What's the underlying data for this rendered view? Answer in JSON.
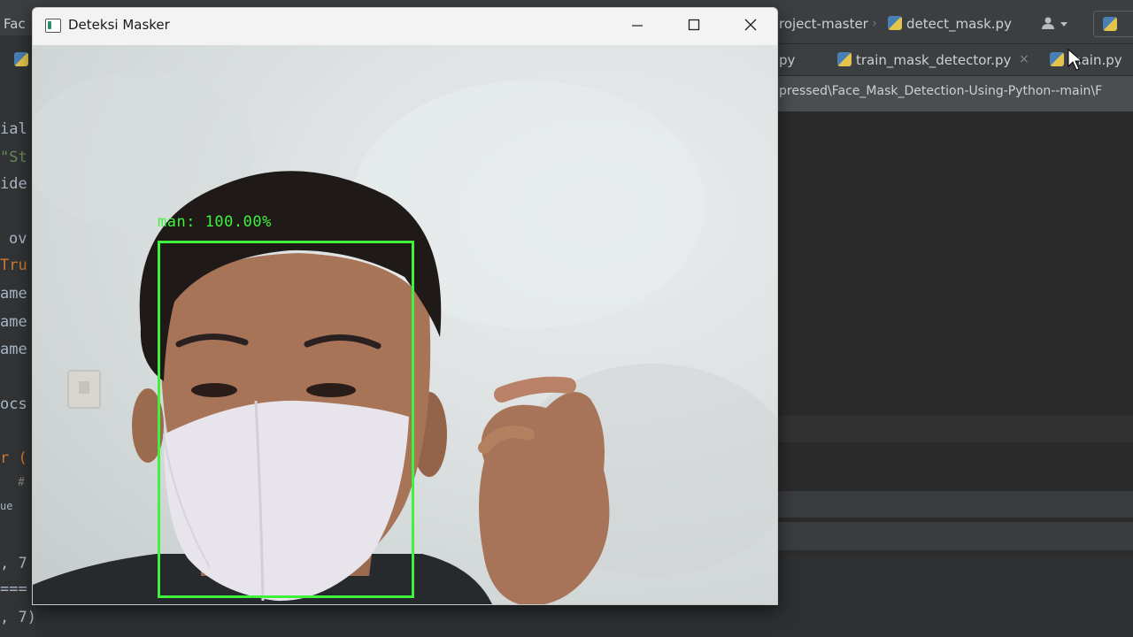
{
  "ide": {
    "project_label_fragment": "Fac",
    "breadcrumb_project": "roject-master",
    "breadcrumb_file": "detect_mask.py",
    "tabs": [
      {
        "label": "py"
      },
      {
        "label": "train_mask_detector.py",
        "close": "×"
      },
      {
        "label": "main.py"
      }
    ],
    "path_text": "pressed\\Face_Mask_Detection-Using-Python--main\\F",
    "code_fragments": [
      "ial",
      "\"St",
      "ide",
      "ov",
      "Tru",
      "ame",
      "ame",
      "ame",
      "ocs",
      "r (",
      "#",
      "ue",
      ", 7",
      "===",
      ", 7)"
    ]
  },
  "window": {
    "title": "Deteksi Masker",
    "minimize_icon": "minimize-icon",
    "maximize_icon": "maximize-icon",
    "close_icon": "close-icon"
  },
  "detection": {
    "label": "man: 100.00%",
    "confidence_percent": 100.0,
    "box_color": "#3ef23e"
  },
  "colors": {
    "ide_bg": "#2b2b2b",
    "ide_toolbar": "#3c3f41",
    "window_titlebar": "#f3f3f3",
    "detect_green": "#3ef23e"
  }
}
